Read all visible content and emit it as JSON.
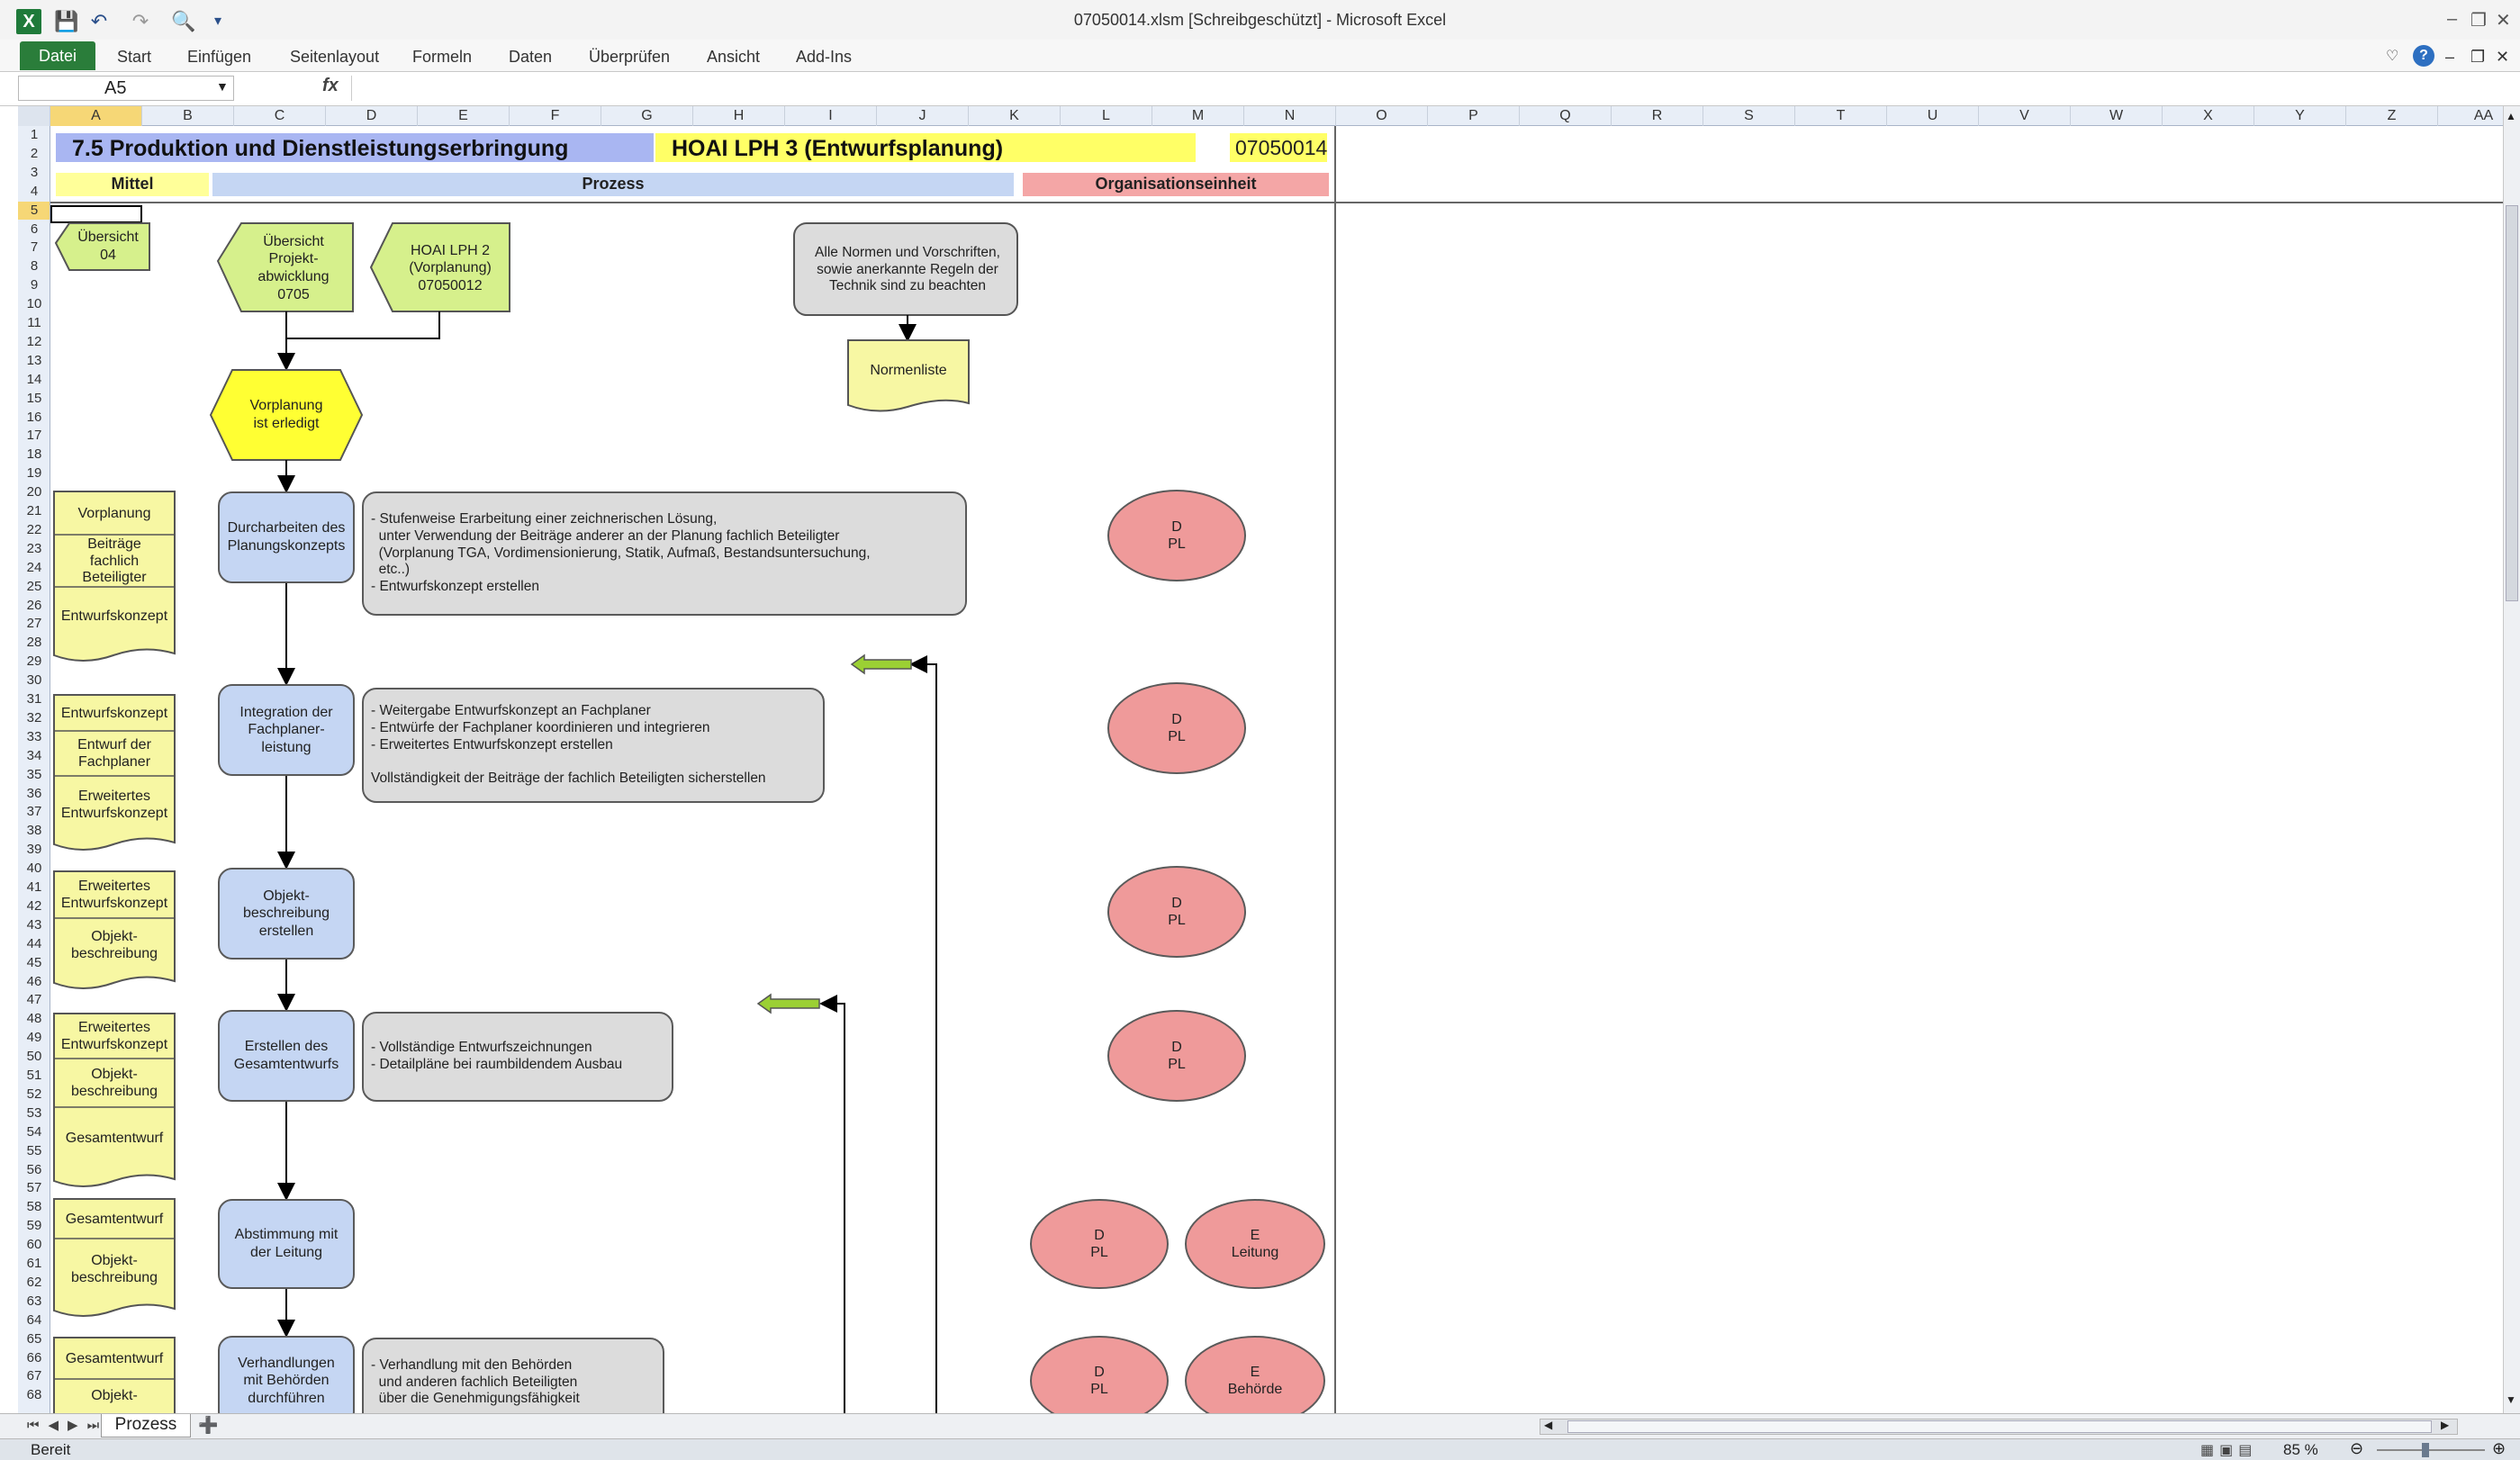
{
  "window": {
    "title": "07050014.xlsm  [Schreibgeschützt] - Microsoft Excel"
  },
  "ribbon": {
    "tabs": [
      "Datei",
      "Start",
      "Einfügen",
      "Seitenlayout",
      "Formeln",
      "Daten",
      "Überprüfen",
      "Ansicht",
      "Add-Ins"
    ]
  },
  "formula_bar": {
    "name_box": "A5",
    "fx_label": "fx",
    "formula": ""
  },
  "columns": [
    "A",
    "B",
    "C",
    "D",
    "E",
    "F",
    "G",
    "H",
    "I",
    "J",
    "K",
    "L",
    "M",
    "N",
    "O",
    "P",
    "Q",
    "R",
    "S",
    "T",
    "U",
    "V",
    "W",
    "X",
    "Y",
    "Z",
    "AA"
  ],
  "selected_column": "A",
  "selected_row": 5,
  "rows_visible": 68,
  "sheet": {
    "header": {
      "section_title": "7.5 Produktion und Dienstleistungserbringung",
      "hoai_title": "HOAI LPH 3 (Entwurfsplanung)",
      "doc_number": "07050014",
      "col_mittel": "Mittel",
      "col_prozess": "Prozess",
      "col_org": "Organisationseinheit"
    },
    "links": {
      "uebersicht_04": "Übersicht\n04",
      "uebersicht_0705": "Übersicht\nProjekt-\nabwicklung\n0705",
      "hoai_lph2": "HOAI LPH 2\n(Vorplanung)\n07050012"
    },
    "notes": {
      "normen": "Alle Normen und Vorschriften,\nsowie anerkannte Regeln der\nTechnik sind zu beachten",
      "normenliste": "Normenliste"
    },
    "start_event": "Vorplanung\nist erledigt",
    "steps": [
      {
        "process": "Durcharbeiten des\nPlanungskonzepts",
        "info": "- Stufenweise Erarbeitung einer zeichnerischen Lösung,\n  unter Verwendung der Beiträge anderer an der Planung fachlich Beteiligter\n  (Vorplanung TGA, Vordimensionierung, Statik, Aufmaß, Bestandsuntersuchung,\n  etc..)\n- Entwurfskonzept erstellen",
        "inputs": [
          "Vorplanung",
          "Beiträge\nfachlich\nBeteiligter",
          "Entwurfskonzept"
        ],
        "roles": [
          "D\nPL"
        ]
      },
      {
        "process": "Integration der\nFachplaner-\nleistung",
        "info": "- Weitergabe Entwurfskonzept an Fachplaner\n- Entwürfe der Fachplaner koordinieren und integrieren\n- Erweitertes Entwurfskonzept erstellen\n\nVollständigkeit der Beiträge der fachlich Beteiligten sicherstellen",
        "inputs": [
          "Entwurfskonzept",
          "Entwurf der\nFachplaner",
          "Erweitertes\nEntwurfskonzept"
        ],
        "roles": [
          "D\nPL"
        ]
      },
      {
        "process": "Objekt-\nbeschreibung\nerstellen",
        "info": "",
        "inputs": [
          "Erweitertes\nEntwurfskonzept",
          "Objekt-\nbeschreibung"
        ],
        "roles": [
          "D\nPL"
        ]
      },
      {
        "process": "Erstellen des\nGesamtentwurfs",
        "info": "- Vollständige Entwurfszeichnungen\n- Detailpläne bei raumbildendem Ausbau",
        "inputs": [
          "Erweitertes\nEntwurfskonzept",
          "Objekt-\nbeschreibung",
          "Gesamtentwurf"
        ],
        "roles": [
          "D\nPL"
        ]
      },
      {
        "process": "Abstimmung mit\nder Leitung",
        "info": "",
        "inputs": [
          "Gesamtentwurf",
          "Objekt-\nbeschreibung"
        ],
        "roles": [
          "D\nPL",
          "E\nLeitung"
        ]
      },
      {
        "process": "Verhandlungen\nmit Behörden\ndurchführen",
        "info": "- Verhandlung mit den Behörden\n  und anderen fachlich Beteiligten\n  über die Genehmigungsfähigkeit",
        "inputs": [
          "Gesamtentwurf",
          "Objekt-"
        ],
        "roles": [
          "D\nPL",
          "E\nBehörde"
        ]
      }
    ]
  },
  "sheet_tabs": [
    "Prozess"
  ],
  "status": {
    "text": "Bereit",
    "zoom": "85 %"
  },
  "colors": {
    "title_band": "#a9b6f2",
    "hoai_band": "#ffff66",
    "mittel_band": "#ffff99",
    "prozess_band": "#c5d6f3",
    "org_band": "#f4a6a6",
    "doc_yellow": "#f7f7a3",
    "link_green": "#d6f08c",
    "event_yellow": "#ffff33",
    "process_blue": "#c5d6f3",
    "role_red": "#ef9a9a"
  }
}
